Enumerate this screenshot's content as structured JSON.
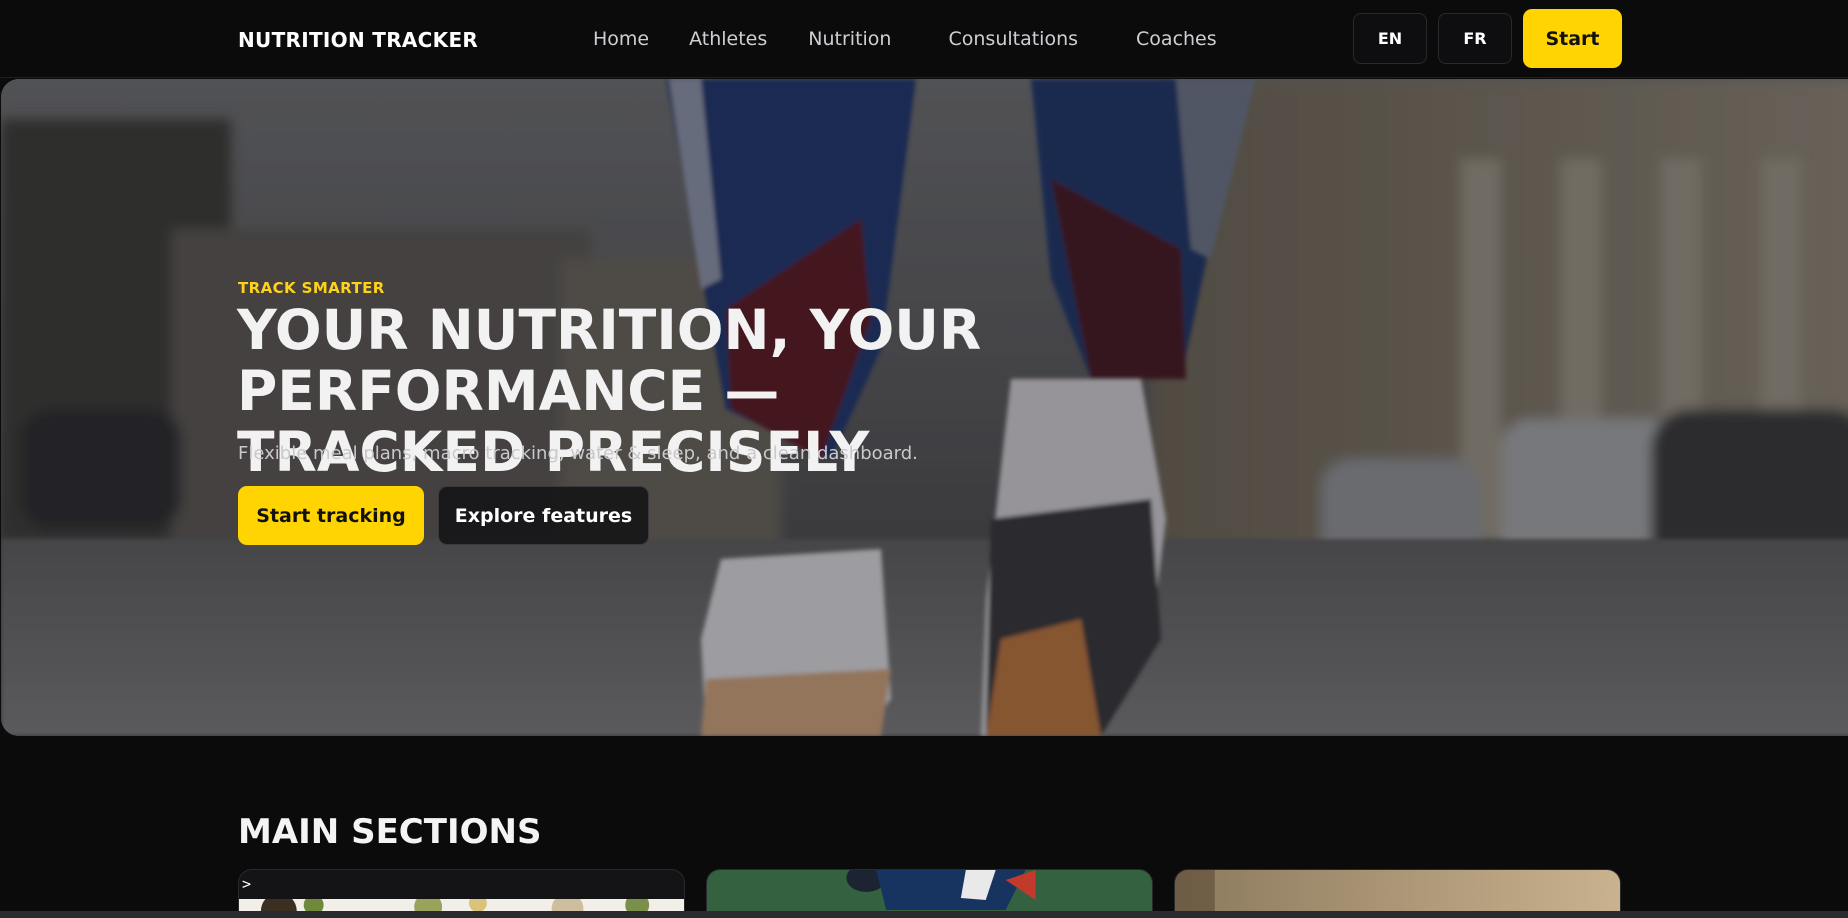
{
  "header": {
    "brand": "NUTRITION TRACKER",
    "nav": [
      "Home",
      "Athletes",
      "Nutrition",
      "Consultations",
      "Coaches"
    ],
    "languages": [
      "EN",
      "FR"
    ],
    "cta": "Start"
  },
  "hero": {
    "eyebrow": "TRACK SMARTER",
    "title_line1": "YOUR NUTRITION, YOUR PERFORMANCE —",
    "title_line2": "TRACKED PRECISELY",
    "subtitle": "Flexible meal plans, macro tracking, water & sleep, and a clean dashboard.",
    "primary_button": "Start tracking",
    "secondary_button": "Explore features"
  },
  "sections": {
    "title": "MAIN SECTIONS",
    "first_card_caret": ">"
  },
  "colors": {
    "accent": "#ffd400",
    "background": "#0b0b0c",
    "eyebrow": "#ffd21a"
  }
}
